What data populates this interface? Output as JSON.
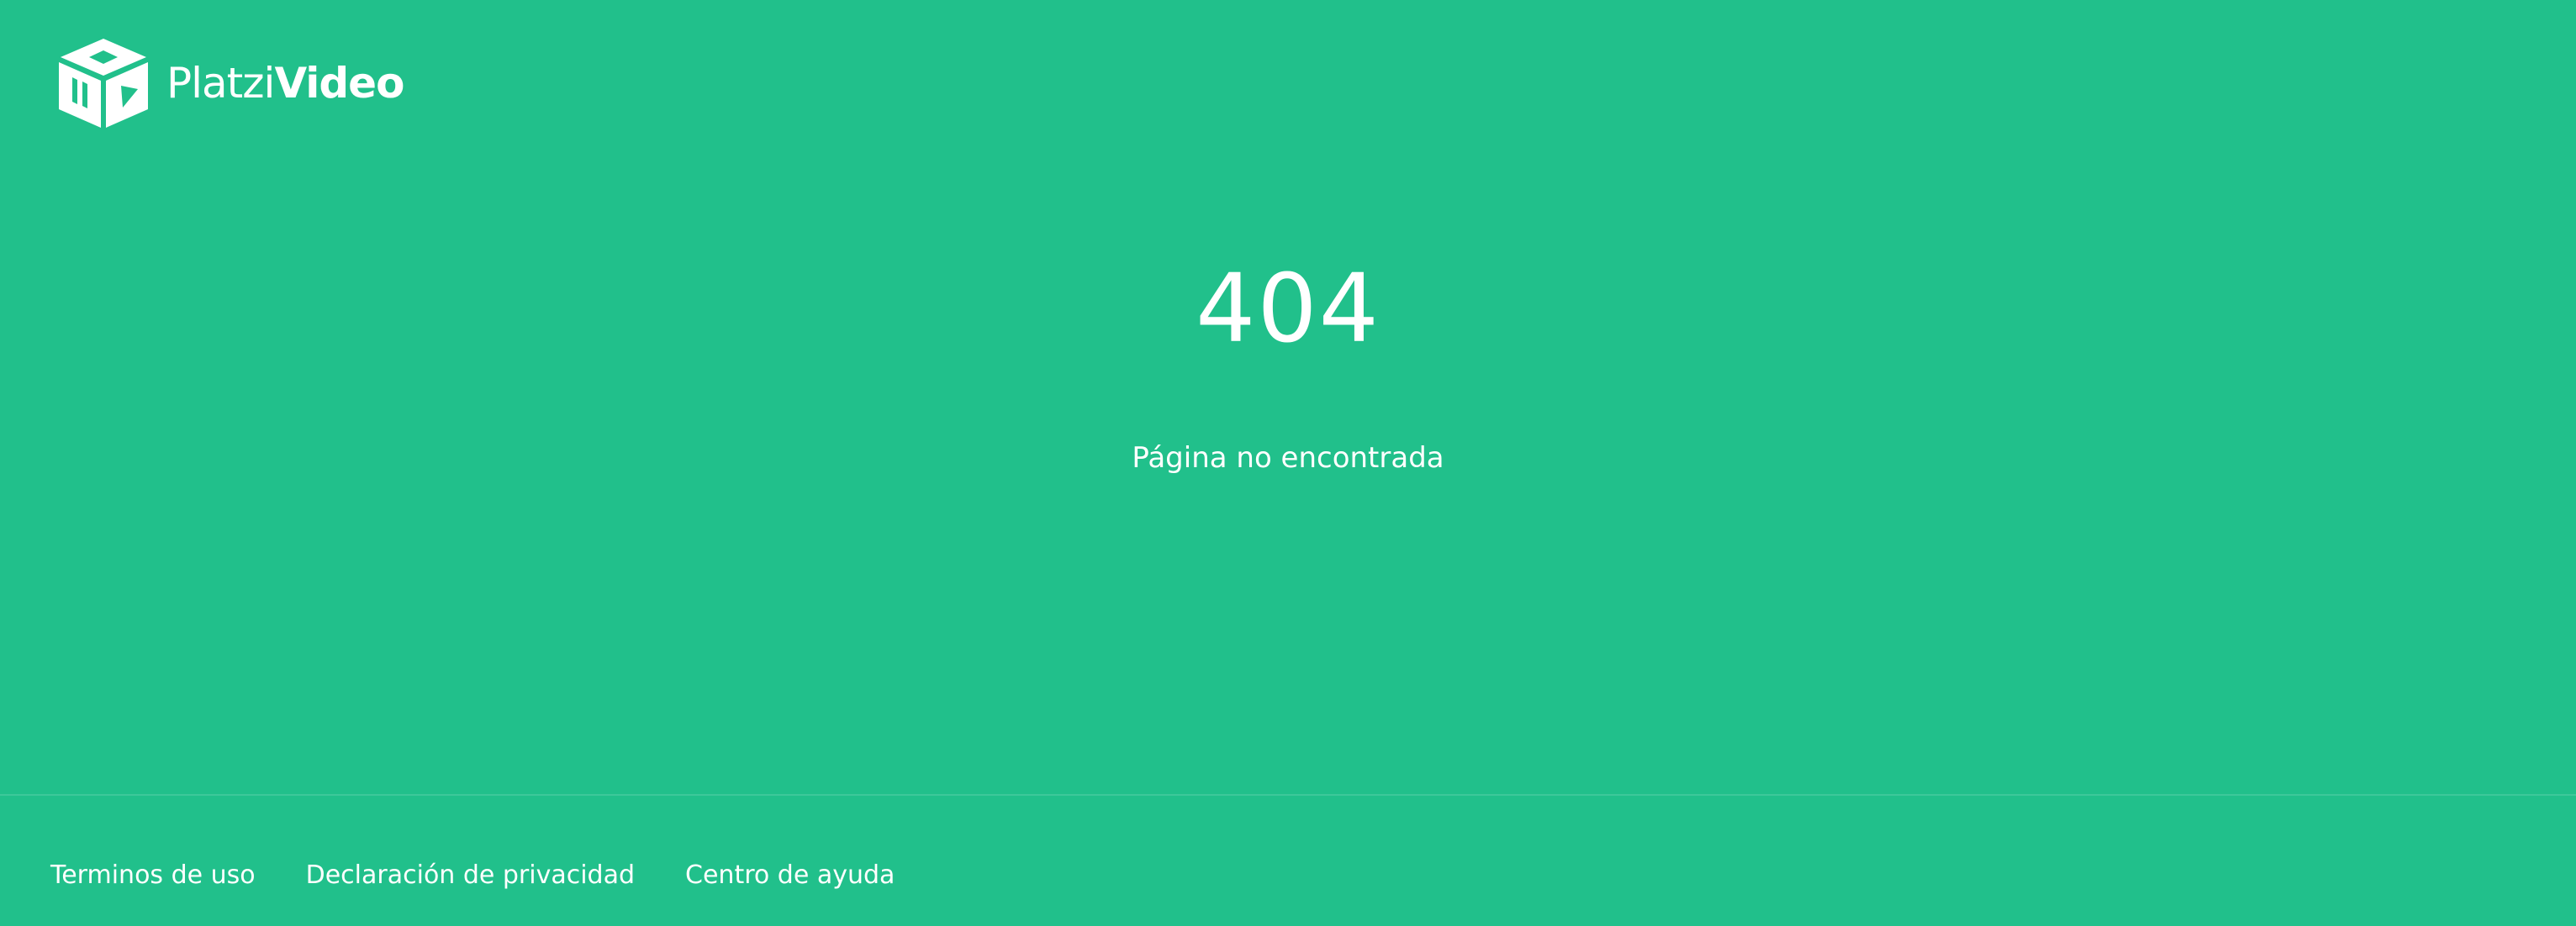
{
  "brand": {
    "name_light": "Platzi",
    "name_bold": "Video",
    "logo_icon": "cube-play-icon"
  },
  "colors": {
    "background": "#21c08b",
    "text": "#ffffff"
  },
  "error": {
    "code": "404",
    "message": "Página no encontrada"
  },
  "footer": {
    "links": [
      {
        "label": "Terminos de uso"
      },
      {
        "label": "Declaración de privacidad"
      },
      {
        "label": "Centro de ayuda"
      }
    ]
  }
}
